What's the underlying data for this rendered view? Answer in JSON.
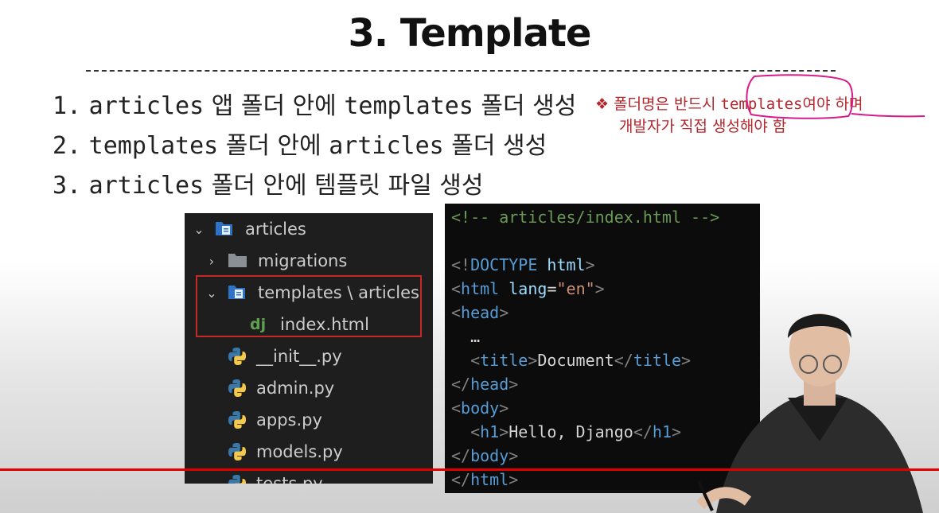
{
  "slide": {
    "title": "3. Template",
    "steps": [
      {
        "num": "1.",
        "parts": [
          {
            "t": "articles",
            "mono": true
          },
          {
            "t": " 앱 폴더 안에 ",
            "mono": false
          },
          {
            "t": "templates",
            "mono": true
          },
          {
            "t": " 폴더 생성",
            "mono": false
          }
        ]
      },
      {
        "num": "2.",
        "parts": [
          {
            "t": "templates",
            "mono": true
          },
          {
            "t": " 폴더 안에 ",
            "mono": false
          },
          {
            "t": "articles",
            "mono": true
          },
          {
            "t": " 폴더 생성",
            "mono": false
          }
        ]
      },
      {
        "num": "3.",
        "parts": [
          {
            "t": "articles",
            "mono": true
          },
          {
            "t": " 폴더 안에 템플릿 파일 생성",
            "mono": false
          }
        ]
      }
    ],
    "note": {
      "bullet": "❖",
      "before": "폴더명은 반드시 ",
      "keyword": "templates",
      "after": "여야 하며",
      "line2": "개발자가 직접 생성해야 함",
      "color": "#b3262b"
    }
  },
  "explorer": {
    "rows": [
      {
        "name": "articles",
        "chevron": "⌄",
        "icon": "folder-open-blue-icon",
        "indent": 0
      },
      {
        "name": "migrations",
        "chevron": "›",
        "icon": "folder-gray-icon",
        "indent": 1
      },
      {
        "name": "templates \\ articles",
        "chevron": "⌄",
        "icon": "folder-open-blue-icon",
        "indent": 1
      },
      {
        "name": "index.html",
        "chevron": "",
        "icon": "django-icon",
        "icon_text": "dj",
        "indent": 2
      },
      {
        "name": "__init__.py",
        "chevron": "",
        "icon": "python-icon",
        "indent": 1
      },
      {
        "name": "admin.py",
        "chevron": "",
        "icon": "python-icon",
        "indent": 1
      },
      {
        "name": "apps.py",
        "chevron": "",
        "icon": "python-icon",
        "indent": 1
      },
      {
        "name": "models.py",
        "chevron": "",
        "icon": "python-icon",
        "indent": 1
      },
      {
        "name": "tests.py",
        "chevron": "",
        "icon": "python-icon",
        "indent": 1
      }
    ],
    "highlight_color": "#c62828"
  },
  "code": {
    "lines": [
      [
        {
          "t": "<!-- articles/index.html -->",
          "c": "comment"
        }
      ],
      [],
      [
        {
          "t": "<!",
          "c": "punct"
        },
        {
          "t": "DOCTYPE",
          "c": "tag"
        },
        {
          "t": " html",
          "c": "attr"
        },
        {
          "t": ">",
          "c": "punct"
        }
      ],
      [
        {
          "t": "<",
          "c": "punct"
        },
        {
          "t": "html",
          "c": "tag"
        },
        {
          "t": " lang",
          "c": "attr"
        },
        {
          "t": "=",
          "c": "text"
        },
        {
          "t": "\"en\"",
          "c": "str"
        },
        {
          "t": ">",
          "c": "punct"
        }
      ],
      [
        {
          "t": "<",
          "c": "punct"
        },
        {
          "t": "head",
          "c": "tag"
        },
        {
          "t": ">",
          "c": "punct"
        }
      ],
      [
        {
          "t": "  …",
          "c": "text"
        }
      ],
      [
        {
          "t": "  <",
          "c": "punct"
        },
        {
          "t": "title",
          "c": "tag"
        },
        {
          "t": ">",
          "c": "punct"
        },
        {
          "t": "Document",
          "c": "text"
        },
        {
          "t": "</",
          "c": "punct"
        },
        {
          "t": "title",
          "c": "tag"
        },
        {
          "t": ">",
          "c": "punct"
        }
      ],
      [
        {
          "t": "</",
          "c": "punct"
        },
        {
          "t": "head",
          "c": "tag"
        },
        {
          "t": ">",
          "c": "punct"
        }
      ],
      [
        {
          "t": "<",
          "c": "punct"
        },
        {
          "t": "body",
          "c": "tag"
        },
        {
          "t": ">",
          "c": "punct"
        }
      ],
      [
        {
          "t": "  <",
          "c": "punct"
        },
        {
          "t": "h1",
          "c": "tag"
        },
        {
          "t": ">",
          "c": "punct"
        },
        {
          "t": "Hello, Django",
          "c": "text"
        },
        {
          "t": "</",
          "c": "punct"
        },
        {
          "t": "h1",
          "c": "tag"
        },
        {
          "t": ">",
          "c": "punct"
        }
      ],
      [
        {
          "t": "</",
          "c": "punct"
        },
        {
          "t": "body",
          "c": "tag"
        },
        {
          "t": ">",
          "c": "punct"
        }
      ],
      [
        {
          "t": "</",
          "c": "punct"
        },
        {
          "t": "html",
          "c": "tag"
        },
        {
          "t": ">",
          "c": "punct"
        }
      ]
    ]
  },
  "video": {
    "progress_color": "#e00000"
  }
}
